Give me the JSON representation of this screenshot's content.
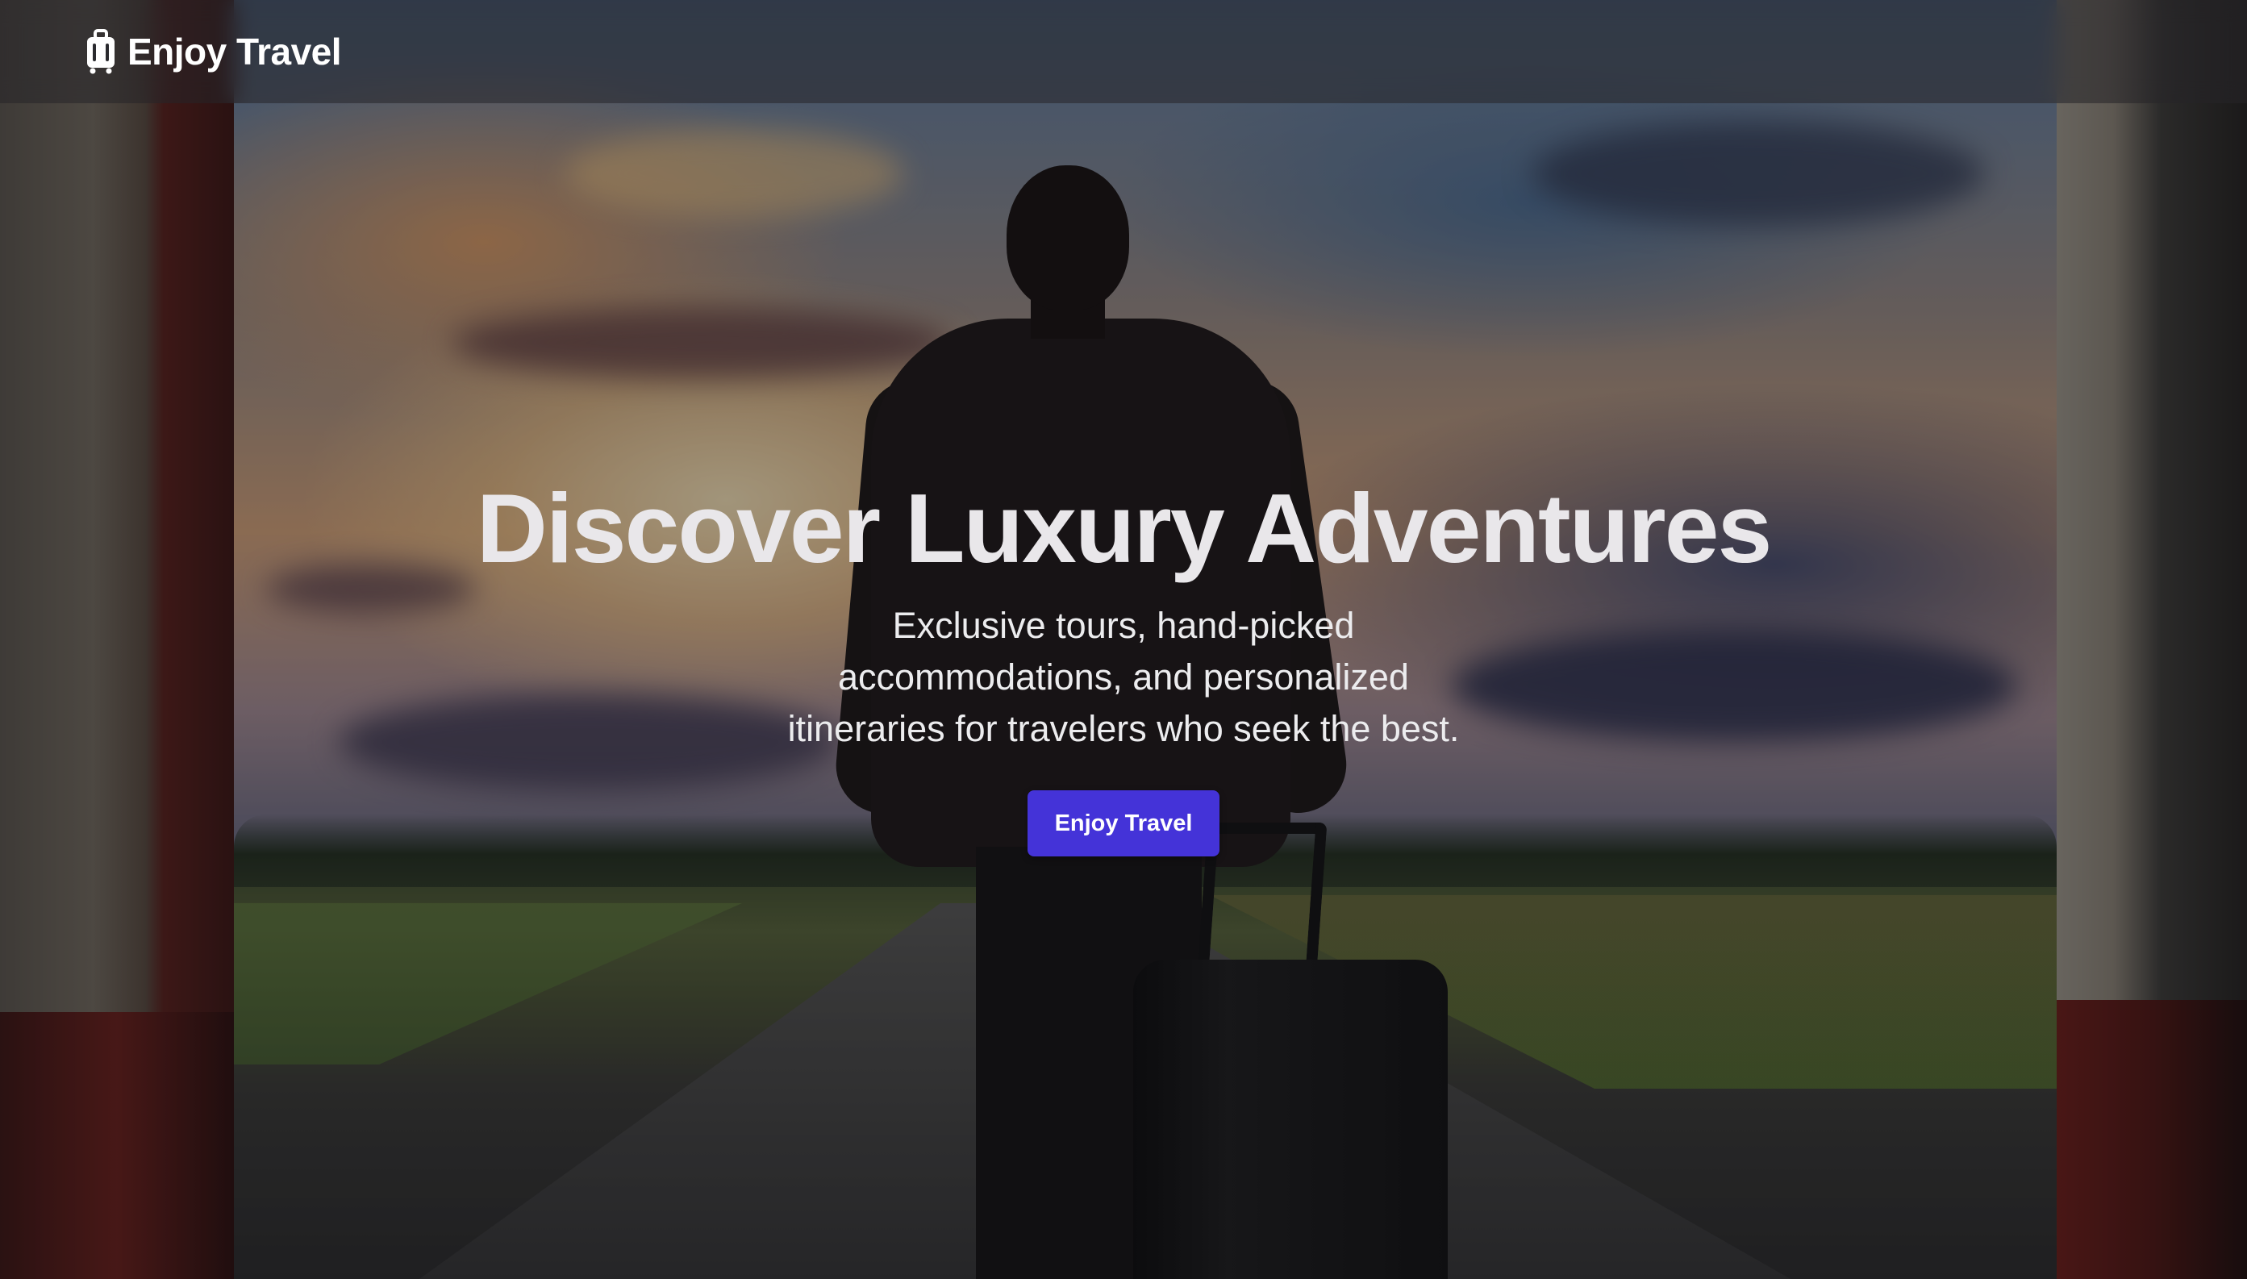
{
  "header": {
    "brand_icon": "suitcase-icon",
    "brand_label": "Enjoy Travel"
  },
  "hero": {
    "title": "Discover Luxury Adventures",
    "subtitle": "Exclusive tours, hand-picked accommodations, and personalized itineraries for travelers who seek the best.",
    "cta_label": "Enjoy Travel"
  },
  "colors": {
    "accent": "#4433d8",
    "header_bg": "#262428",
    "title_text": "#e9e7ea"
  }
}
